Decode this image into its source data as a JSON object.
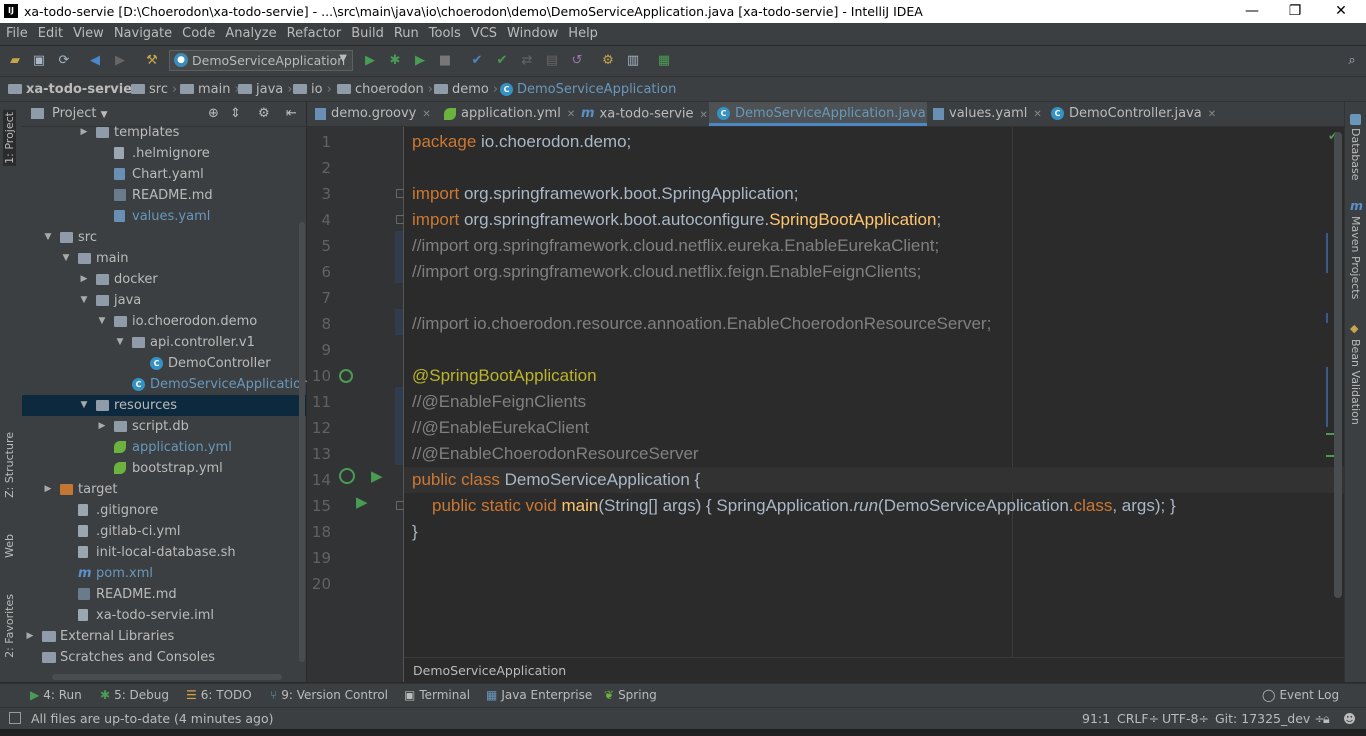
{
  "window": {
    "title": "xa-todo-servie [D:\\Choerodon\\xa-todo-servie] - ...\\src\\main\\java\\io\\choerodon\\demo\\DemoServiceApplication.java [xa-todo-servie] - IntelliJ IDEA",
    "minimize": "—",
    "maximize": "❐",
    "close": "✕"
  },
  "menu": [
    "File",
    "Edit",
    "View",
    "Navigate",
    "Code",
    "Analyze",
    "Refactor",
    "Build",
    "Run",
    "Tools",
    "VCS",
    "Window",
    "Help"
  ],
  "toolbar": {
    "run_config": "DemoServiceApplication"
  },
  "breadcrumb": [
    "xa-todo-servie",
    "src",
    "main",
    "java",
    "io",
    "choerodon",
    "demo",
    "DemoServiceApplication"
  ],
  "left_stripe": {
    "project": "1: Project",
    "structure": "Z: Structure",
    "web": "Web",
    "favorites": "2: Favorites"
  },
  "right_stripe": {
    "database": "Database",
    "maven": "Maven Projects",
    "bean": "Bean Validation"
  },
  "project_panel": {
    "title": "Project",
    "tree": [
      {
        "label": "templates",
        "type": "folder",
        "indent": 2,
        "arrow": "▶"
      },
      {
        "label": ".helmignore",
        "type": "file",
        "indent": 3
      },
      {
        "label": "Chart.yaml",
        "type": "yaml",
        "indent": 3
      },
      {
        "label": "README.md",
        "type": "md",
        "indent": 3
      },
      {
        "label": "values.yaml",
        "type": "yaml",
        "indent": 3,
        "blue": true
      },
      {
        "label": "src",
        "type": "folder",
        "indent": 0,
        "arrow": "▼"
      },
      {
        "label": "main",
        "type": "folder",
        "indent": 1,
        "arrow": "▼"
      },
      {
        "label": "docker",
        "type": "folder",
        "indent": 2,
        "arrow": "▶"
      },
      {
        "label": "java",
        "type": "folder",
        "indent": 2,
        "arrow": "▼"
      },
      {
        "label": "io.choerodon.demo",
        "type": "folder",
        "indent": 3,
        "arrow": "▼"
      },
      {
        "label": "api.controller.v1",
        "type": "folder",
        "indent": 4,
        "arrow": "▼"
      },
      {
        "label": "DemoController",
        "type": "java",
        "indent": 5
      },
      {
        "label": "DemoServiceApplication",
        "type": "java",
        "indent": 4,
        "blue": true
      },
      {
        "label": "resources",
        "type": "folder",
        "indent": 2,
        "arrow": "▼",
        "selected": true
      },
      {
        "label": "script.db",
        "type": "folder",
        "indent": 3,
        "arrow": "▶"
      },
      {
        "label": "application.yml",
        "type": "spring",
        "indent": 3,
        "blue": true
      },
      {
        "label": "bootstrap.yml",
        "type": "spring",
        "indent": 3
      },
      {
        "label": "target",
        "type": "folder-orange",
        "indent": 0,
        "arrow": "▶"
      },
      {
        "label": ".gitignore",
        "type": "file",
        "indent": 1
      },
      {
        "label": ".gitlab-ci.yml",
        "type": "file",
        "indent": 1
      },
      {
        "label": "init-local-database.sh",
        "type": "file",
        "indent": 1
      },
      {
        "label": "pom.xml",
        "type": "maven",
        "indent": 1,
        "blue": true
      },
      {
        "label": "README.md",
        "type": "md",
        "indent": 1
      },
      {
        "label": "xa-todo-servie.iml",
        "type": "file",
        "indent": 1
      },
      {
        "label": "External Libraries",
        "type": "lib",
        "indent": -1,
        "arrow": "▶"
      },
      {
        "label": "Scratches and Consoles",
        "type": "lib",
        "indent": -1
      }
    ]
  },
  "tabs": [
    {
      "label": "demo.groovy",
      "icon": "groovy"
    },
    {
      "label": "application.yml",
      "icon": "spring"
    },
    {
      "label": "xa-todo-servie",
      "icon": "maven"
    },
    {
      "label": "DemoServiceApplication.java",
      "icon": "java",
      "active": true
    },
    {
      "label": "values.yaml",
      "icon": "yaml"
    },
    {
      "label": "DemoController.java",
      "icon": "java"
    }
  ],
  "editor": {
    "line_numbers": [
      "1",
      "2",
      "3",
      "4",
      "5",
      "6",
      "7",
      "8",
      "9",
      "10",
      "11",
      "12",
      "13",
      "14",
      "15",
      "18",
      "19",
      "20"
    ],
    "footer": "DemoServiceApplication"
  },
  "code": {
    "l1_kw": "package",
    "l1_rest": " io.choerodon.demo;",
    "l3_kw": "import",
    "l3_rest": " org.springframework.boot.SpringApplication;",
    "l4_kw": "import",
    "l4_rest": " org.springframework.boot.autoconfigure.",
    "l4_ann": "SpringBootApplication",
    "l4_end": ";",
    "l5": "//import org.springframework.cloud.netflix.eureka.EnableEurekaClient;",
    "l6": "//import org.springframework.cloud.netflix.feign.EnableFeignClients;",
    "l8": "//import io.choerodon.resource.annoation.EnableChoerodonResourceServer;",
    "l10": "@SpringBootApplication",
    "l11": "//@EnableFeignClients",
    "l12": "//@EnableEurekaClient",
    "l13": "//@EnableChoerodonResourceServer",
    "l14_kw": "public class",
    "l14_rest": " DemoServiceApplication {",
    "l15_kw": "public static void",
    "l15_mt": "main",
    "l15_a": "(String[] args) { SpringApplication.",
    "l15_it": "run",
    "l15_b": "(DemoServiceApplication.",
    "l15_kw2": "class",
    "l15_c": ", args); }",
    "l18": "}"
  },
  "bottom_tools": [
    {
      "label": "4: Run",
      "glyph": "▶",
      "color": "#499c54"
    },
    {
      "label": "5: Debug",
      "glyph": "✱",
      "color": "#499c54"
    },
    {
      "label": "6: TODO",
      "glyph": "☰",
      "color": "#d9a343"
    },
    {
      "label": "9: Version Control",
      "glyph": "⑂",
      "color": "#6897bb"
    },
    {
      "label": "Terminal",
      "glyph": "▣",
      "color": "#bbbbbb"
    },
    {
      "label": "Java Enterprise",
      "glyph": "▦",
      "color": "#6897bb"
    },
    {
      "label": "Spring",
      "glyph": "❦",
      "color": "#6cb33e"
    }
  ],
  "event_log": "Event Log",
  "status": {
    "message": "All files are up-to-date (4 minutes ago)",
    "position": "91:1",
    "line_sep": "CRLF÷",
    "encoding": "UTF-8÷",
    "git": "Git: 17325_dev ÷"
  }
}
